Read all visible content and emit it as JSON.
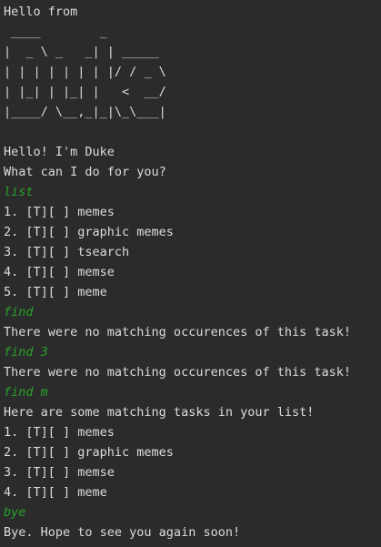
{
  "console": {
    "lines": [
      {
        "text": "Hello from",
        "kind": "output"
      },
      {
        "text": " ____        _        ",
        "kind": "output"
      },
      {
        "text": "|  _ \\ _   _| | _____ ",
        "kind": "output"
      },
      {
        "text": "| | | | | | | |/ / _ \\",
        "kind": "output"
      },
      {
        "text": "| |_| | |_| |   <  __/",
        "kind": "output"
      },
      {
        "text": "|____/ \\__,_|_|\\_\\___|",
        "kind": "output"
      },
      {
        "text": "",
        "kind": "output"
      },
      {
        "text": "Hello! I'm Duke",
        "kind": "output"
      },
      {
        "text": "What can I do for you?",
        "kind": "output"
      },
      {
        "text": "list",
        "kind": "input"
      },
      {
        "text": "1. [T][ ] memes",
        "kind": "output"
      },
      {
        "text": "2. [T][ ] graphic memes",
        "kind": "output"
      },
      {
        "text": "3. [T][ ] tsearch",
        "kind": "output"
      },
      {
        "text": "4. [T][ ] memse",
        "kind": "output"
      },
      {
        "text": "5. [T][ ] meme",
        "kind": "output"
      },
      {
        "text": "find",
        "kind": "input"
      },
      {
        "text": "There were no matching occurences of this task!",
        "kind": "output"
      },
      {
        "text": "find 3",
        "kind": "input"
      },
      {
        "text": "There were no matching occurences of this task!",
        "kind": "output"
      },
      {
        "text": "find m",
        "kind": "input"
      },
      {
        "text": "Here are some matching tasks in your list!",
        "kind": "output"
      },
      {
        "text": "1. [T][ ] memes",
        "kind": "output"
      },
      {
        "text": "2. [T][ ] graphic memes",
        "kind": "output"
      },
      {
        "text": "3. [T][ ] memse",
        "kind": "output"
      },
      {
        "text": "4. [T][ ] meme",
        "kind": "output"
      },
      {
        "text": "bye",
        "kind": "input"
      },
      {
        "text": "Bye. Hope to see you again soon!",
        "kind": "output"
      }
    ]
  },
  "colors": {
    "background": "#2b2b2b",
    "output_text": "#dcdcdc",
    "input_text": "#29a329"
  }
}
